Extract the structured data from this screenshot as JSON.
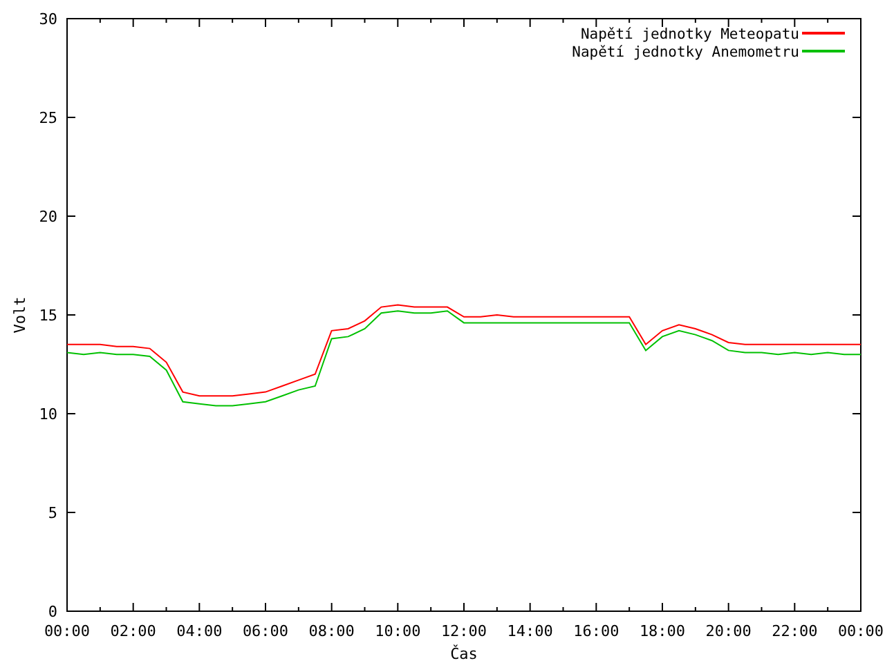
{
  "chart": {
    "chart_data": {
      "type": "line",
      "xlabel": "Čas",
      "ylabel": "Volt",
      "x": [
        0,
        0.5,
        1,
        1.5,
        2,
        2.5,
        3,
        3.5,
        4,
        4.5,
        5,
        5.5,
        6,
        6.5,
        7,
        7.5,
        8,
        8.5,
        9,
        9.5,
        10,
        10.5,
        11,
        11.5,
        12,
        12.5,
        13,
        13.5,
        14,
        14.5,
        15,
        15.5,
        16,
        16.5,
        17,
        17.5,
        18,
        18.5,
        19,
        19.5,
        20,
        20.5,
        21,
        21.5,
        22,
        22.5,
        23,
        23.5,
        24
      ],
      "series": [
        {
          "name": "Napětí jednotky Meteopatu",
          "color": "#ff0000",
          "values": [
            13.5,
            13.5,
            13.5,
            13.4,
            13.4,
            13.3,
            12.6,
            11.1,
            10.9,
            10.9,
            10.9,
            11.0,
            11.1,
            11.4,
            11.7,
            12.0,
            14.2,
            14.3,
            14.7,
            15.4,
            15.5,
            15.4,
            15.4,
            15.4,
            14.9,
            14.9,
            15.0,
            14.9,
            14.9,
            14.9,
            14.9,
            14.9,
            14.9,
            14.9,
            14.9,
            13.5,
            14.2,
            14.5,
            14.3,
            14.0,
            13.6,
            13.5,
            13.5,
            13.5,
            13.5,
            13.5,
            13.5,
            13.5,
            13.5
          ]
        },
        {
          "name": "Napětí jednotky Anemometru",
          "color": "#00c000",
          "values": [
            13.1,
            13.0,
            13.1,
            13.0,
            13.0,
            12.9,
            12.2,
            10.6,
            10.5,
            10.4,
            10.4,
            10.5,
            10.6,
            10.9,
            11.2,
            11.4,
            13.8,
            13.9,
            14.3,
            15.1,
            15.2,
            15.1,
            15.1,
            15.2,
            14.6,
            14.6,
            14.6,
            14.6,
            14.6,
            14.6,
            14.6,
            14.6,
            14.6,
            14.6,
            14.6,
            13.2,
            13.9,
            14.2,
            14.0,
            13.7,
            13.2,
            13.1,
            13.1,
            13.0,
            13.1,
            13.0,
            13.1,
            13.0,
            13.0
          ]
        }
      ],
      "legend": "top-right",
      "xlim": [
        0,
        24
      ],
      "ylim": [
        0,
        30
      ],
      "xticks": [
        {
          "value": 0,
          "label": "00:00"
        },
        {
          "value": 2,
          "label": "02:00"
        },
        {
          "value": 4,
          "label": "04:00"
        },
        {
          "value": 6,
          "label": "06:00"
        },
        {
          "value": 8,
          "label": "08:00"
        },
        {
          "value": 10,
          "label": "10:00"
        },
        {
          "value": 12,
          "label": "12:00"
        },
        {
          "value": 14,
          "label": "14:00"
        },
        {
          "value": 16,
          "label": "16:00"
        },
        {
          "value": 18,
          "label": "18:00"
        },
        {
          "value": 20,
          "label": "20:00"
        },
        {
          "value": 22,
          "label": "22:00"
        },
        {
          "value": 24,
          "label": "00:00"
        }
      ],
      "yticks": [
        0,
        5,
        10,
        15,
        20,
        25,
        30
      ]
    }
  }
}
